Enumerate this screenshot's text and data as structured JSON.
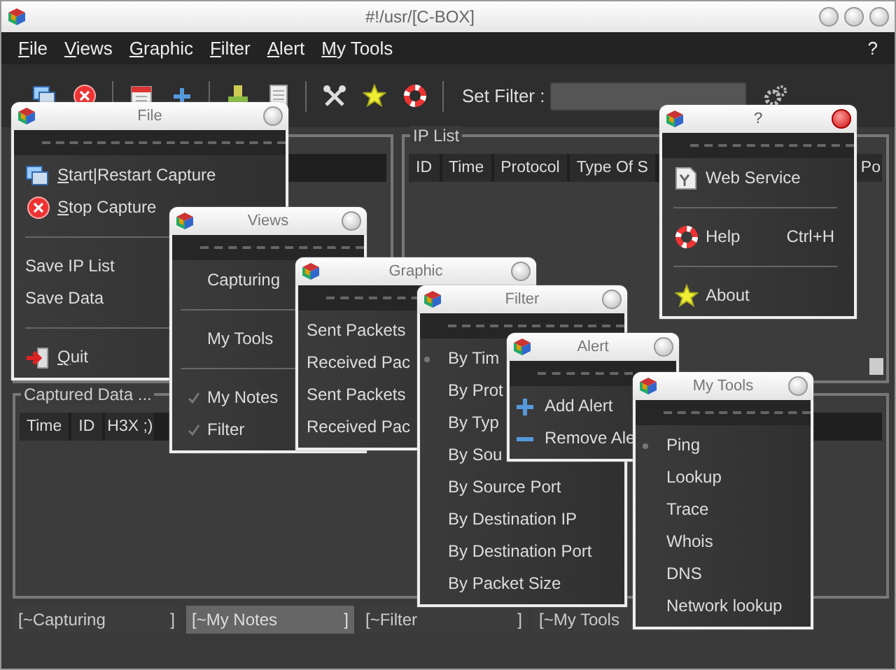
{
  "window": {
    "title": "#!/usr/[C-BOX]"
  },
  "menubar": {
    "items": [
      "File",
      "Views",
      "Graphic",
      "Filter",
      "Alert",
      "My Tools"
    ],
    "help": "?"
  },
  "toolbar": {
    "filter_label": "Set Filter :"
  },
  "ip_list": {
    "title": "IP List",
    "columns": [
      "ID",
      "Time",
      "Protocol",
      "Type Of S",
      "Po"
    ]
  },
  "captured_data": {
    "title": "Captured Data ...",
    "columns": [
      "Time",
      "ID",
      "H3X ;)"
    ]
  },
  "status_fields": [
    {
      "label": "[~Capturing",
      "end": "]",
      "selected": false
    },
    {
      "label": "[~My Notes",
      "end": "]",
      "selected": true
    },
    {
      "label": "[~Filter",
      "end": "]",
      "selected": false
    },
    {
      "label": "[~My Tools",
      "selected": false
    }
  ],
  "menus": [
    {
      "title": "File",
      "active": false,
      "items": [
        {
          "kind": "icon",
          "label": "Start|Restart Capture"
        },
        {
          "kind": "icon",
          "label": "Stop Capture"
        },
        {
          "kind": "separator"
        },
        {
          "kind": "plain",
          "label": "Save IP List"
        },
        {
          "kind": "plain",
          "label": "Save Data"
        },
        {
          "kind": "separator"
        },
        {
          "kind": "icon",
          "label": "Quit"
        }
      ]
    },
    {
      "title": "Views",
      "active": false,
      "items": [
        {
          "kind": "check",
          "label": "Capturing",
          "checked": false
        },
        {
          "kind": "separator"
        },
        {
          "kind": "check",
          "label": "My Tools",
          "checked": false
        },
        {
          "kind": "separator"
        },
        {
          "kind": "check",
          "label": "My Notes",
          "checked": true
        },
        {
          "kind": "check",
          "label": "Filter",
          "checked": true
        }
      ]
    },
    {
      "title": "Graphic",
      "active": false,
      "items": [
        {
          "kind": "plain",
          "label": "Sent Packets"
        },
        {
          "kind": "plain",
          "label": "Received Pac"
        },
        {
          "kind": "plain",
          "label": "Sent Packets"
        },
        {
          "kind": "plain",
          "label": "Received Pac"
        }
      ]
    },
    {
      "title": "Filter",
      "active": false,
      "items": [
        {
          "kind": "radio",
          "label": "By Tim",
          "selected": true
        },
        {
          "kind": "radio",
          "label": "By Prot",
          "selected": false
        },
        {
          "kind": "radio",
          "label": "By Typ",
          "selected": false
        },
        {
          "kind": "radio",
          "label": "By Sou",
          "selected": false
        },
        {
          "kind": "radio",
          "label": "By Source Port",
          "selected": false
        },
        {
          "kind": "radio",
          "label": "By Destination IP",
          "selected": false
        },
        {
          "kind": "radio",
          "label": "By Destination Port",
          "selected": false
        },
        {
          "kind": "radio",
          "label": "By Packet Size",
          "selected": false
        }
      ]
    },
    {
      "title": "Alert",
      "active": false,
      "items": [
        {
          "kind": "icon",
          "label": "Add Alert"
        },
        {
          "kind": "icon",
          "label": "Remove Ale"
        }
      ]
    },
    {
      "title": "My Tools",
      "active": false,
      "items": [
        {
          "kind": "radio",
          "label": "Ping",
          "selected": true
        },
        {
          "kind": "radio",
          "label": "Lookup",
          "selected": false
        },
        {
          "kind": "radio",
          "label": "Trace",
          "selected": false
        },
        {
          "kind": "radio",
          "label": "Whois",
          "selected": false
        },
        {
          "kind": "radio",
          "label": "DNS",
          "selected": false
        },
        {
          "kind": "radio",
          "label": "Network lookup",
          "selected": false
        }
      ]
    },
    {
      "title": "?",
      "active": true,
      "items": [
        {
          "kind": "icon",
          "label": "Web Service"
        },
        {
          "kind": "separator"
        },
        {
          "kind": "icon",
          "label": "Help",
          "shortcut": "Ctrl+H"
        },
        {
          "kind": "separator"
        },
        {
          "kind": "icon",
          "label": "About"
        }
      ]
    }
  ]
}
